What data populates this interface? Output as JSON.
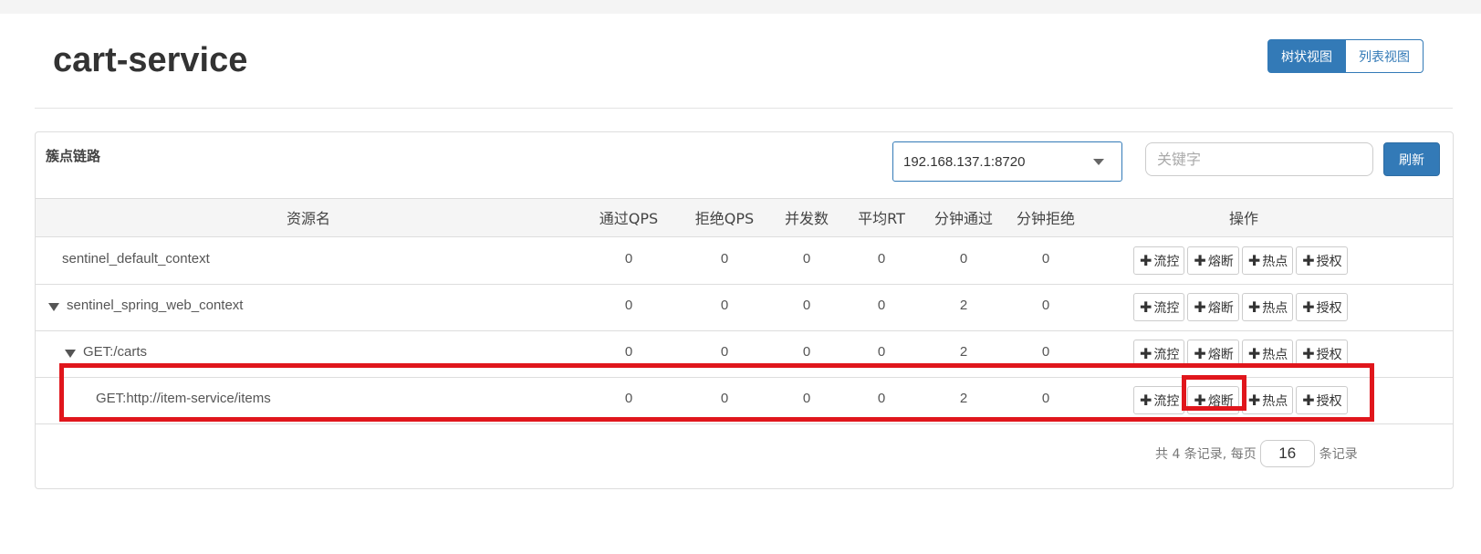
{
  "page_title": "cart-service",
  "view_toggle": {
    "tree_label": "树状视图",
    "list_label": "列表视图",
    "active": "tree"
  },
  "panel": {
    "title": "簇点链路",
    "machine_select": "192.168.137.1:8720",
    "search_placeholder": "关键字",
    "refresh_label": "刷新"
  },
  "table": {
    "headers": {
      "resource": "资源名",
      "pass_qps": "通过QPS",
      "block_qps": "拒绝QPS",
      "concurrency": "并发数",
      "avg_rt": "平均RT",
      "minute_pass": "分钟通过",
      "minute_block": "分钟拒绝",
      "ops": "操作"
    },
    "rows": [
      {
        "name": "sentinel_default_context",
        "pass_qps": "0",
        "block_qps": "0",
        "concurrency": "0",
        "avg_rt": "0",
        "minute_pass": "0",
        "minute_block": "0",
        "expanded": false
      },
      {
        "name": "sentinel_spring_web_context",
        "pass_qps": "0",
        "block_qps": "0",
        "concurrency": "0",
        "avg_rt": "0",
        "minute_pass": "2",
        "minute_block": "0",
        "expanded": true
      },
      {
        "name": "GET:/carts",
        "pass_qps": "0",
        "block_qps": "0",
        "concurrency": "0",
        "avg_rt": "0",
        "minute_pass": "2",
        "minute_block": "0",
        "expanded": true
      },
      {
        "name": "GET:http://item-service/items",
        "pass_qps": "0",
        "block_qps": "0",
        "concurrency": "0",
        "avg_rt": "0",
        "minute_pass": "2",
        "minute_block": "0",
        "expanded": false
      }
    ],
    "op_buttons": {
      "flow": "流控",
      "degrade": "熔断",
      "hotspot": "热点",
      "auth": "授权"
    },
    "plus_glyph": "✚"
  },
  "pagination": {
    "total_text": "共 4 条记录, 每页",
    "page_size": "16",
    "suffix": "条记录"
  },
  "colors": {
    "primary": "#337ab7",
    "highlight": "#e0161c"
  }
}
